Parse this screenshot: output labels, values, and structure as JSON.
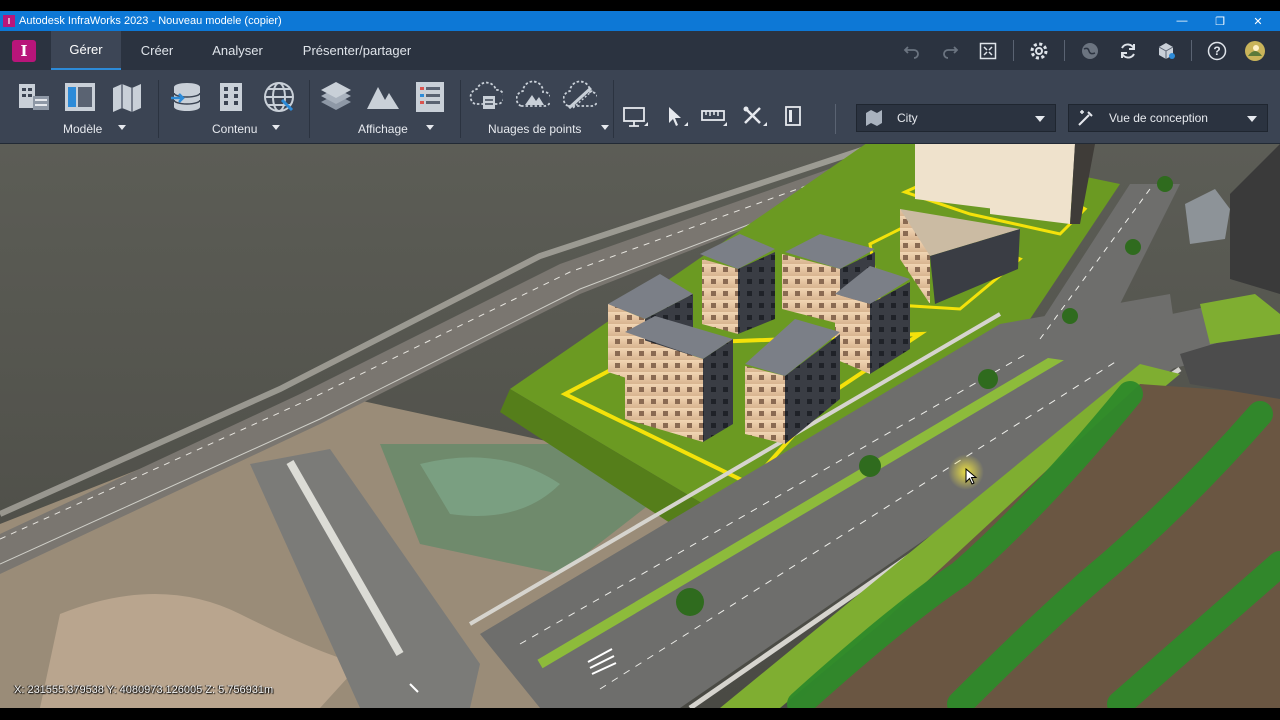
{
  "window": {
    "title": "Autodesk InfraWorks 2023 - Nouveau modele (copier)",
    "app_icon_letter": "I",
    "minimize": "—",
    "maximize": "❐",
    "close": "✕"
  },
  "tabs": [
    {
      "label": "Gérer",
      "active": true
    },
    {
      "label": "Créer",
      "active": false
    },
    {
      "label": "Analyser",
      "active": false
    },
    {
      "label": "Présenter/partager",
      "active": false
    }
  ],
  "toolbar_right": {
    "icons": [
      "undo-icon",
      "redo-icon",
      "fit-view-icon",
      "settings-gear-icon",
      "globe-icon",
      "sync-icon",
      "cube-icon",
      "help-icon",
      "user-avatar"
    ],
    "help_glyph": "?"
  },
  "ribbon": {
    "groups": [
      {
        "label": "Modèle"
      },
      {
        "label": "Contenu"
      },
      {
        "label": "Affichage"
      },
      {
        "label": "Nuages de points"
      }
    ],
    "style_dropdown": {
      "value": "City"
    },
    "view_dropdown": {
      "value": "Vue de conception"
    }
  },
  "viewport": {
    "coordinates": "X: 231555.379538 Y: 4080973.126005 Z: 5.756931m"
  },
  "colors": {
    "title_bar": "#0d78d6",
    "tabs_bar": "#2b3340",
    "ribbon": "#3b4453",
    "brand_magenta": "#b8157a",
    "selection_yellow": "#f4e20a",
    "lawn_green": "#6b9a22"
  }
}
